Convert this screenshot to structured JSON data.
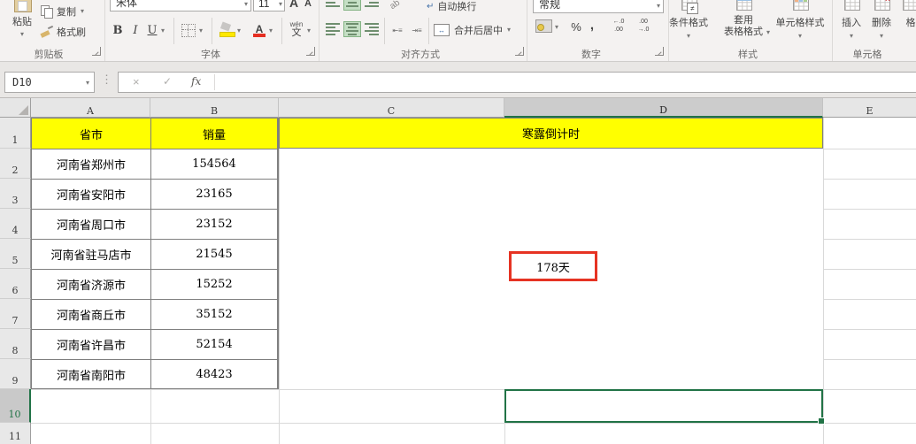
{
  "ribbon": {
    "clipboard": {
      "label": "剪贴板",
      "paste": "粘贴",
      "copy": "复制",
      "format_painter": "格式刷"
    },
    "font": {
      "label": "字体",
      "name": "宋体",
      "size": "11",
      "bold": "B",
      "italic": "I",
      "underline": "U",
      "color_letter": "A",
      "grow": "A",
      "shrink": "A",
      "phonetic_top": "wén",
      "phonetic_bottom": "文"
    },
    "alignment": {
      "label": "对齐方式",
      "wrap": "自动换行",
      "merge": "合并后居中"
    },
    "number": {
      "label": "数字",
      "format": "常规",
      "percent": "%",
      "comma": ",",
      "inc_top": "←.0",
      "inc_bottom": ".00",
      "dec_top": ".00",
      "dec_bottom": "→.0"
    },
    "styles": {
      "label": "样式",
      "conditional": "条件格式",
      "neq": "≠",
      "format_table_1": "套用",
      "format_table_2": "表格格式",
      "cell_styles": "单元格样式"
    },
    "cells": {
      "label": "单元格",
      "insert": "插入",
      "delete": "删除",
      "format": "格"
    }
  },
  "formula_bar": {
    "name_box": "D10",
    "formula": "",
    "fx": "fx"
  },
  "icons": {
    "chevron": "▾",
    "cancel": "×",
    "enter": "✓",
    "dots": "⋮",
    "wrap_return": "↵",
    "merge_arrows": "↔"
  },
  "sheet": {
    "col_headers": [
      "A",
      "B",
      "C",
      "D",
      "E"
    ],
    "row_headers": [
      "1",
      "2",
      "3",
      "4",
      "5",
      "6",
      "7",
      "8",
      "9",
      "10",
      "11"
    ],
    "header_row": {
      "province": "省市",
      "sales": "销量",
      "countdown_title": "寒露倒计时"
    },
    "data": [
      [
        "河南省郑州市",
        "154564"
      ],
      [
        "河南省安阳市",
        "23165"
      ],
      [
        "河南省周口市",
        "23152"
      ],
      [
        "河南省驻马店市",
        "21545"
      ],
      [
        "河南省济源市",
        "15252"
      ],
      [
        "河南省商丘市",
        "35152"
      ],
      [
        "河南省许昌市",
        "52154"
      ],
      [
        "河南省南阳市",
        "48423"
      ]
    ],
    "countdown_value": "178天",
    "selected_cell": "D10"
  },
  "colors": {
    "selection_green": "#217346",
    "header_fill_yellow": "#ffff00",
    "countdown_border_red": "#e63323",
    "active_align_green": "#c5dfc5"
  }
}
